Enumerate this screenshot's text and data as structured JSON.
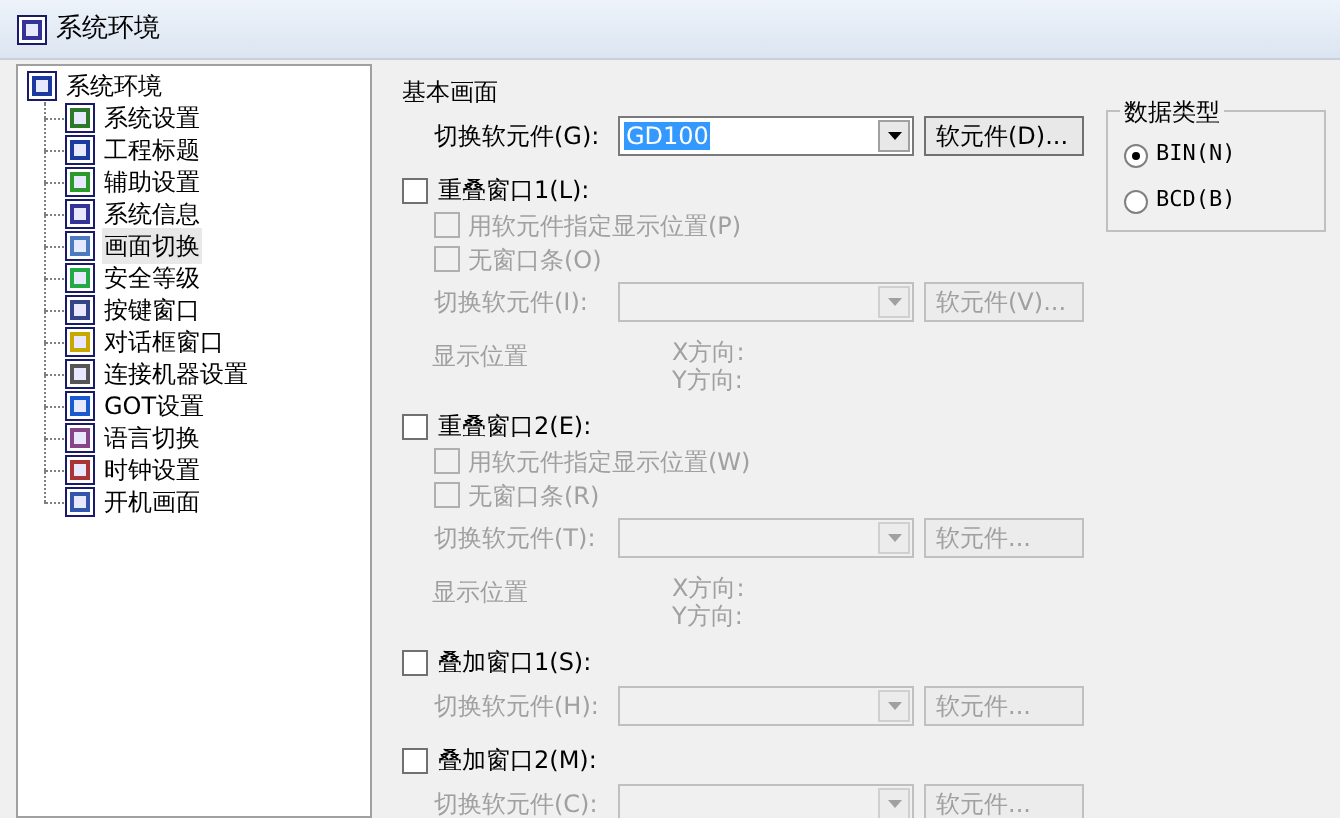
{
  "window": {
    "title": "系统环境"
  },
  "tree": {
    "label": "系统环境",
    "children": [
      {
        "label": "系统设置",
        "selected": false
      },
      {
        "label": "工程标题",
        "selected": false
      },
      {
        "label": "辅助设置",
        "selected": false
      },
      {
        "label": "系统信息",
        "selected": false
      },
      {
        "label": "画面切换",
        "selected": true
      },
      {
        "label": "安全等级",
        "selected": false
      },
      {
        "label": "按键窗口",
        "selected": false
      },
      {
        "label": "对话框窗口",
        "selected": false
      },
      {
        "label": "连接机器设置",
        "selected": false
      },
      {
        "label": "GOT设置",
        "selected": false
      },
      {
        "label": "语言切换",
        "selected": false
      },
      {
        "label": "时钟设置",
        "selected": false
      },
      {
        "label": "开机画面",
        "selected": false
      }
    ]
  },
  "base_screen": {
    "heading": "基本画面",
    "device_label": "切换软元件(G):",
    "value": "GD100",
    "button": "软元件(D)..."
  },
  "data_type": {
    "title": "数据类型",
    "options": [
      {
        "label": "BIN(N)",
        "selected": true
      },
      {
        "label": "BCD(B)",
        "selected": false
      }
    ]
  },
  "windows": [
    {
      "label": "重叠窗口1(L):",
      "checked": false,
      "options": [
        {
          "label": "用软元件指定显示位置(P)",
          "checked": false
        },
        {
          "label": "无窗口条(O)",
          "checked": false
        }
      ],
      "device_label": "切换软元件(I):",
      "button": "软元件(V)...",
      "position": {
        "label": "显示位置",
        "x": "X方向:",
        "y": "Y方向:"
      }
    },
    {
      "label": "重叠窗口2(E):",
      "checked": false,
      "options": [
        {
          "label": "用软元件指定显示位置(W)",
          "checked": false
        },
        {
          "label": "无窗口条(R)",
          "checked": false
        }
      ],
      "device_label": "切换软元件(T):",
      "button": "软元件...",
      "position": {
        "label": "显示位置",
        "x": "X方向:",
        "y": "Y方向:"
      }
    },
    {
      "label": "叠加窗口1(S):",
      "checked": false,
      "device_label": "切换软元件(H):",
      "button": "软元件..."
    },
    {
      "label": "叠加窗口2(M):",
      "checked": false,
      "device_label": "切换软元件(C):",
      "button": "软元件..."
    }
  ]
}
